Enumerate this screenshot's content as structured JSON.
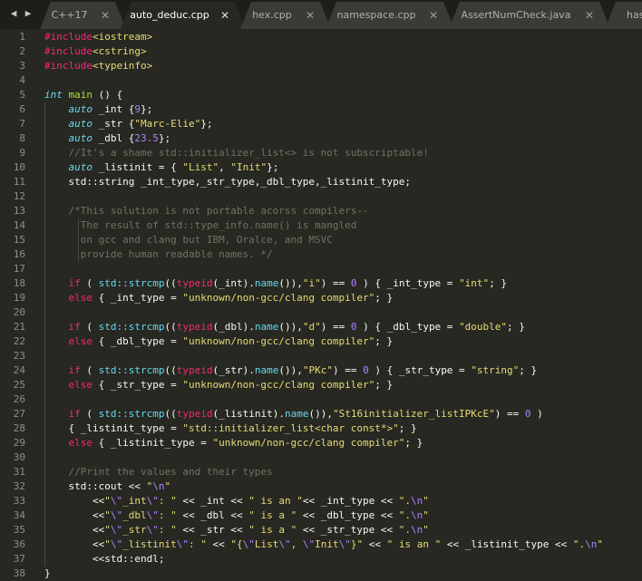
{
  "tabs": [
    {
      "label": "C++17",
      "close": "✕"
    },
    {
      "label": "auto_deduc.cpp",
      "close": "✕",
      "active": true
    },
    {
      "label": "hex.cpp",
      "close": "✕"
    },
    {
      "label": "namespace.cpp",
      "close": "✕"
    },
    {
      "label": "AssertNumCheck.java",
      "close": "✕"
    },
    {
      "label": "has",
      "close": ""
    }
  ],
  "nav": {
    "back": "◀",
    "forward": "▶"
  },
  "theme": {
    "background": "#272822",
    "tabbar": "#1d1e1a",
    "keyword": "#f92672",
    "string": "#e6db74",
    "type": "#66d9ef",
    "function": "#a6e22e",
    "number": "#ae81ff",
    "comment": "#75715e"
  },
  "lines": [
    {
      "n": "1",
      "tokens": [
        [
          "pre",
          "#include"
        ],
        [
          "str",
          "<iostream>"
        ]
      ]
    },
    {
      "n": "2",
      "tokens": [
        [
          "pre",
          "#include"
        ],
        [
          "str",
          "<cstring>"
        ]
      ]
    },
    {
      "n": "3",
      "tokens": [
        [
          "pre",
          "#include"
        ],
        [
          "str",
          "<typeinfo>"
        ]
      ]
    },
    {
      "n": "4",
      "tokens": []
    },
    {
      "n": "5",
      "tokens": [
        [
          "type",
          "int"
        ],
        [
          "plain",
          " "
        ],
        [
          "fn",
          "main"
        ],
        [
          "plain",
          " () {"
        ]
      ]
    },
    {
      "n": "6",
      "tokens": [
        [
          "plain",
          "    "
        ],
        [
          "type",
          "auto"
        ],
        [
          "plain",
          " _int {"
        ],
        [
          "num",
          "9"
        ],
        [
          "plain",
          "};"
        ]
      ]
    },
    {
      "n": "7",
      "tokens": [
        [
          "plain",
          "    "
        ],
        [
          "type",
          "auto"
        ],
        [
          "plain",
          " _str {"
        ],
        [
          "str",
          "\"Marc-Elie\""
        ],
        [
          "plain",
          "};"
        ]
      ]
    },
    {
      "n": "8",
      "tokens": [
        [
          "plain",
          "    "
        ],
        [
          "type",
          "auto"
        ],
        [
          "plain",
          " _dbl {"
        ],
        [
          "num",
          "23.5"
        ],
        [
          "plain",
          "};"
        ]
      ]
    },
    {
      "n": "9",
      "tokens": [
        [
          "plain",
          "    "
        ],
        [
          "cmt",
          "//It's a shame std::initializer_list<> is not subscriptable!"
        ]
      ]
    },
    {
      "n": "10",
      "tokens": [
        [
          "plain",
          "    "
        ],
        [
          "type",
          "auto"
        ],
        [
          "plain",
          " _listinit = { "
        ],
        [
          "str",
          "\"List\""
        ],
        [
          "plain",
          ", "
        ],
        [
          "str",
          "\"Init\""
        ],
        [
          "plain",
          "};"
        ]
      ]
    },
    {
      "n": "11",
      "tokens": [
        [
          "plain",
          "    std::string _int_type,_str_type,_dbl_type,_listinit_type;"
        ]
      ]
    },
    {
      "n": "12",
      "tokens": []
    },
    {
      "n": "13",
      "tokens": [
        [
          "plain",
          "    "
        ],
        [
          "cmt",
          "/*This solution is not portable acorss compilers--"
        ]
      ]
    },
    {
      "n": "14",
      "tokens": [
        [
          "plain",
          "    "
        ],
        [
          "cmt",
          "  The result of std::type_info.name() is mangled"
        ]
      ]
    },
    {
      "n": "15",
      "tokens": [
        [
          "plain",
          "    "
        ],
        [
          "cmt",
          "  on gcc and clang but IBM, Oralce, and MSVC"
        ]
      ]
    },
    {
      "n": "16",
      "tokens": [
        [
          "plain",
          "    "
        ],
        [
          "cmt",
          "  provide human readable names. */"
        ]
      ]
    },
    {
      "n": "17",
      "tokens": []
    },
    {
      "n": "18",
      "tokens": [
        [
          "plain",
          "    "
        ],
        [
          "kw",
          "if"
        ],
        [
          "plain",
          " ( "
        ],
        [
          "ns",
          "std::strcmp"
        ],
        [
          "plain",
          "(("
        ],
        [
          "kw",
          "typeid"
        ],
        [
          "plain",
          "(_int)."
        ],
        [
          "ns",
          "name"
        ],
        [
          "plain",
          "()),"
        ],
        [
          "str",
          "\"i\""
        ],
        [
          "plain",
          ") == "
        ],
        [
          "num",
          "0"
        ],
        [
          "plain",
          " ) { _int_type = "
        ],
        [
          "str",
          "\"int\""
        ],
        [
          "plain",
          "; }"
        ]
      ]
    },
    {
      "n": "19",
      "tokens": [
        [
          "plain",
          "    "
        ],
        [
          "kw",
          "else"
        ],
        [
          "plain",
          " { _int_type = "
        ],
        [
          "str",
          "\"unknown/non-gcc/clang compiler\""
        ],
        [
          "plain",
          "; }"
        ]
      ]
    },
    {
      "n": "20",
      "tokens": []
    },
    {
      "n": "21",
      "tokens": [
        [
          "plain",
          "    "
        ],
        [
          "kw",
          "if"
        ],
        [
          "plain",
          " ( "
        ],
        [
          "ns",
          "std::strcmp"
        ],
        [
          "plain",
          "(("
        ],
        [
          "kw",
          "typeid"
        ],
        [
          "plain",
          "(_dbl)."
        ],
        [
          "ns",
          "name"
        ],
        [
          "plain",
          "()),"
        ],
        [
          "str",
          "\"d\""
        ],
        [
          "plain",
          ") == "
        ],
        [
          "num",
          "0"
        ],
        [
          "plain",
          " ) { _dbl_type = "
        ],
        [
          "str",
          "\"double\""
        ],
        [
          "plain",
          "; }"
        ]
      ]
    },
    {
      "n": "22",
      "tokens": [
        [
          "plain",
          "    "
        ],
        [
          "kw",
          "else"
        ],
        [
          "plain",
          " { _dbl_type = "
        ],
        [
          "str",
          "\"unknown/non-gcc/clang compiler\""
        ],
        [
          "plain",
          "; }"
        ]
      ]
    },
    {
      "n": "23",
      "tokens": []
    },
    {
      "n": "24",
      "tokens": [
        [
          "plain",
          "    "
        ],
        [
          "kw",
          "if"
        ],
        [
          "plain",
          " ( "
        ],
        [
          "ns",
          "std::strcmp"
        ],
        [
          "plain",
          "(("
        ],
        [
          "kw",
          "typeid"
        ],
        [
          "plain",
          "(_str)."
        ],
        [
          "ns",
          "name"
        ],
        [
          "plain",
          "()),"
        ],
        [
          "str",
          "\"PKc\""
        ],
        [
          "plain",
          ") == "
        ],
        [
          "num",
          "0"
        ],
        [
          "plain",
          " ) { _str_type = "
        ],
        [
          "str",
          "\"string\""
        ],
        [
          "plain",
          "; }"
        ]
      ]
    },
    {
      "n": "25",
      "tokens": [
        [
          "plain",
          "    "
        ],
        [
          "kw",
          "else"
        ],
        [
          "plain",
          " { _str_type = "
        ],
        [
          "str",
          "\"unknown/non-gcc/clang compiler\""
        ],
        [
          "plain",
          "; }"
        ]
      ]
    },
    {
      "n": "26",
      "tokens": []
    },
    {
      "n": "27",
      "tokens": [
        [
          "plain",
          "    "
        ],
        [
          "kw",
          "if"
        ],
        [
          "plain",
          " ( "
        ],
        [
          "ns",
          "std::strcmp"
        ],
        [
          "plain",
          "(("
        ],
        [
          "kw",
          "typeid"
        ],
        [
          "plain",
          "(_listinit)."
        ],
        [
          "ns",
          "name"
        ],
        [
          "plain",
          "()),"
        ],
        [
          "str",
          "\"St16initializer_listIPKcE\""
        ],
        [
          "plain",
          ") == "
        ],
        [
          "num",
          "0"
        ],
        [
          "plain",
          " )"
        ]
      ]
    },
    {
      "n": "28",
      "tokens": [
        [
          "plain",
          "    { _listinit_type = "
        ],
        [
          "str",
          "\"std::initializer_list<char const*>\""
        ],
        [
          "plain",
          "; }"
        ]
      ]
    },
    {
      "n": "29",
      "tokens": [
        [
          "plain",
          "    "
        ],
        [
          "kw",
          "else"
        ],
        [
          "plain",
          " { _listinit_type = "
        ],
        [
          "str",
          "\"unknown/non-gcc/clang compiler\""
        ],
        [
          "plain",
          "; }"
        ]
      ]
    },
    {
      "n": "30",
      "tokens": []
    },
    {
      "n": "31",
      "tokens": [
        [
          "plain",
          "    "
        ],
        [
          "cmt",
          "//Print the values and their types"
        ]
      ]
    },
    {
      "n": "32",
      "tokens": [
        [
          "plain",
          "    std::cout << "
        ],
        [
          "str",
          "\""
        ],
        [
          "esc",
          "\\n"
        ],
        [
          "str",
          "\""
        ]
      ]
    },
    {
      "n": "33",
      "tokens": [
        [
          "plain",
          "        <<"
        ],
        [
          "str",
          "\""
        ],
        [
          "esc",
          "\\\""
        ],
        [
          "str",
          "_int"
        ],
        [
          "esc",
          "\\\""
        ],
        [
          "str",
          ": \""
        ],
        [
          "plain",
          " << _int << "
        ],
        [
          "str",
          "\" is an \""
        ],
        [
          "plain",
          "<< _int_type << "
        ],
        [
          "str",
          "\"."
        ],
        [
          "esc",
          "\\n"
        ],
        [
          "str",
          "\""
        ]
      ]
    },
    {
      "n": "34",
      "tokens": [
        [
          "plain",
          "        <<"
        ],
        [
          "str",
          "\""
        ],
        [
          "esc",
          "\\\""
        ],
        [
          "str",
          "_dbl"
        ],
        [
          "esc",
          "\\\""
        ],
        [
          "str",
          ": \""
        ],
        [
          "plain",
          " << _dbl << "
        ],
        [
          "str",
          "\" is a \""
        ],
        [
          "plain",
          " << _dbl_type << "
        ],
        [
          "str",
          "\"."
        ],
        [
          "esc",
          "\\n"
        ],
        [
          "str",
          "\""
        ]
      ]
    },
    {
      "n": "35",
      "tokens": [
        [
          "plain",
          "        <<"
        ],
        [
          "str",
          "\""
        ],
        [
          "esc",
          "\\\""
        ],
        [
          "str",
          "_str"
        ],
        [
          "esc",
          "\\\""
        ],
        [
          "str",
          ": \""
        ],
        [
          "plain",
          " << _str << "
        ],
        [
          "str",
          "\" is a \""
        ],
        [
          "plain",
          " << _str_type << "
        ],
        [
          "str",
          "\"."
        ],
        [
          "esc",
          "\\n"
        ],
        [
          "str",
          "\""
        ]
      ]
    },
    {
      "n": "36",
      "tokens": [
        [
          "plain",
          "        <<"
        ],
        [
          "str",
          "\""
        ],
        [
          "esc",
          "\\\""
        ],
        [
          "str",
          "_listinit"
        ],
        [
          "esc",
          "\\\""
        ],
        [
          "str",
          ": \""
        ],
        [
          "plain",
          " << "
        ],
        [
          "str",
          "\"{"
        ],
        [
          "esc",
          "\\\""
        ],
        [
          "str",
          "List"
        ],
        [
          "esc",
          "\\\""
        ],
        [
          "str",
          ", "
        ],
        [
          "esc",
          "\\\""
        ],
        [
          "str",
          "Init"
        ],
        [
          "esc",
          "\\\""
        ],
        [
          "str",
          "}\""
        ],
        [
          "plain",
          " << "
        ],
        [
          "str",
          "\" is an \""
        ],
        [
          "plain",
          " << _listinit_type << "
        ],
        [
          "str",
          "\"."
        ],
        [
          "esc",
          "\\n"
        ],
        [
          "str",
          "\""
        ]
      ]
    },
    {
      "n": "37",
      "tokens": [
        [
          "plain",
          "        <<std::endl;"
        ]
      ]
    },
    {
      "n": "38",
      "tokens": [
        [
          "plain",
          "}"
        ]
      ]
    }
  ]
}
